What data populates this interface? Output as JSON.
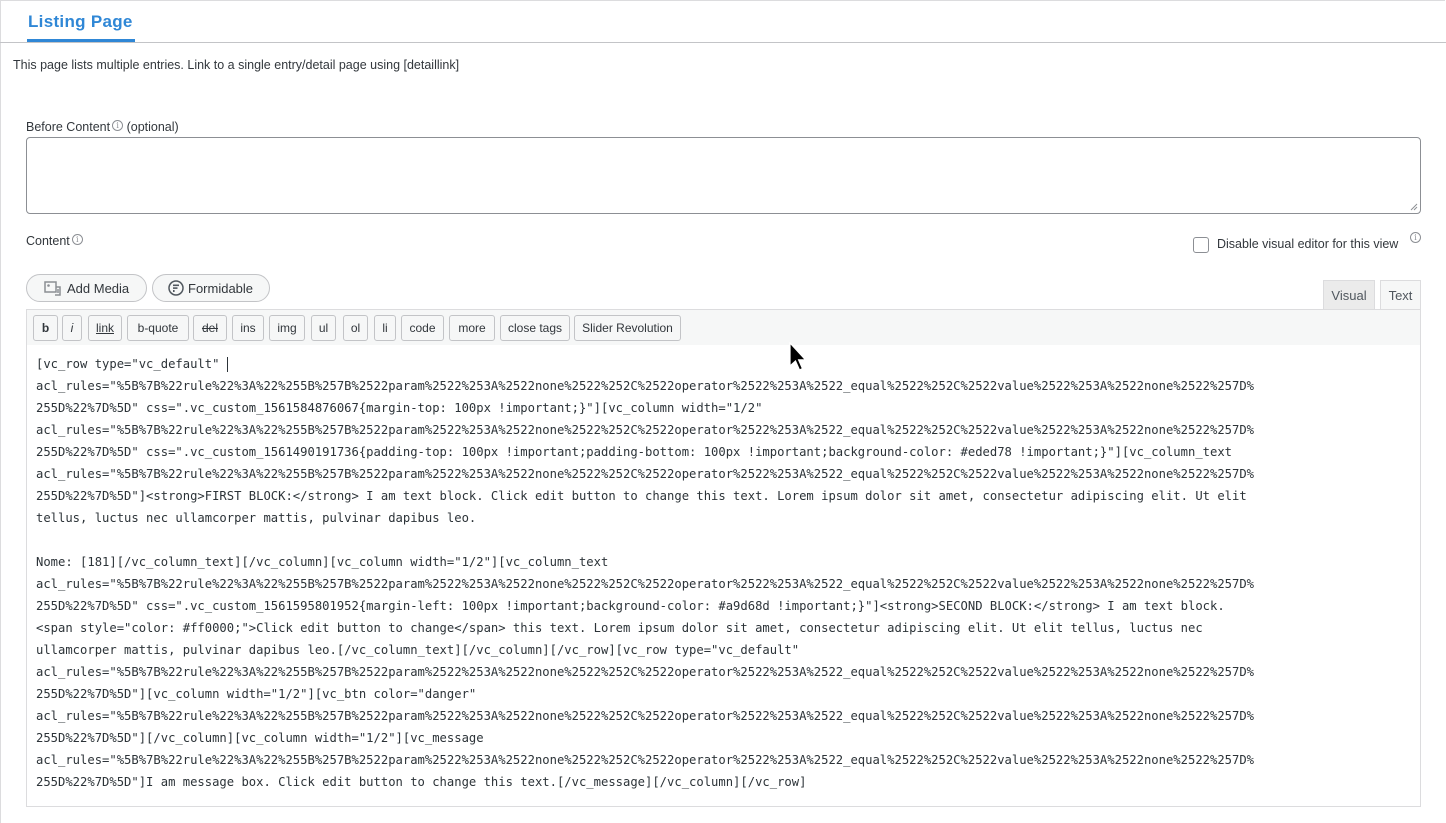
{
  "header": {
    "tab_title": "Listing Page"
  },
  "intro_text": "This page lists multiple entries. Link to a single entry/detail page using [detaillink]",
  "before_content": {
    "label": "Before Content",
    "optional": "(optional)",
    "value": ""
  },
  "content": {
    "label": "Content",
    "disable_visual_label": "Disable visual editor for this view",
    "disable_visual_checked": false
  },
  "media_buttons": {
    "add_media": "Add Media",
    "formidable": "Formidable"
  },
  "editor_tabs": {
    "visual": "Visual",
    "text": "Text",
    "active": "Text"
  },
  "quicktags": [
    "b",
    "i",
    "link",
    "b-quote",
    "del",
    "ins",
    "img",
    "ul",
    "ol",
    "li",
    "code",
    "more",
    "close tags",
    "Slider Revolution"
  ],
  "editor_lines": [
    "[vc_row type=\"vc_default\" ",
    "acl_rules=\"%5B%7B%22rule%22%3A%22%255B%257B%2522param%2522%253A%2522none%2522%252C%2522operator%2522%253A%2522_equal%2522%252C%2522value%2522%253A%2522none%2522%257D%",
    "255D%22%7D%5D\" css=\".vc_custom_1561584876067{margin-top: 100px !important;}\"][vc_column width=\"1/2\"",
    "acl_rules=\"%5B%7B%22rule%22%3A%22%255B%257B%2522param%2522%253A%2522none%2522%252C%2522operator%2522%253A%2522_equal%2522%252C%2522value%2522%253A%2522none%2522%257D%",
    "255D%22%7D%5D\" css=\".vc_custom_1561490191736{padding-top: 100px !important;padding-bottom: 100px !important;background-color: #eded78 !important;}\"][vc_column_text",
    "acl_rules=\"%5B%7B%22rule%22%3A%22%255B%257B%2522param%2522%253A%2522none%2522%252C%2522operator%2522%253A%2522_equal%2522%252C%2522value%2522%253A%2522none%2522%257D%",
    "255D%22%7D%5D\"]<strong>FIRST BLOCK:</strong> I am text block. Click edit button to change this text. Lorem ipsum dolor sit amet, consectetur adipiscing elit. Ut elit",
    "tellus, luctus nec ullamcorper mattis, pulvinar dapibus leo.",
    "",
    "Nome: [181][/vc_column_text][/vc_column][vc_column width=\"1/2\"][vc_column_text",
    "acl_rules=\"%5B%7B%22rule%22%3A%22%255B%257B%2522param%2522%253A%2522none%2522%252C%2522operator%2522%253A%2522_equal%2522%252C%2522value%2522%253A%2522none%2522%257D%",
    "255D%22%7D%5D\" css=\".vc_custom_1561595801952{margin-left: 100px !important;background-color: #a9d68d !important;}\"]<strong>SECOND BLOCK:</strong> I am text block.",
    "<span style=\"color: #ff0000;\">Click edit button to change</span> this text. Lorem ipsum dolor sit amet, consectetur adipiscing elit. Ut elit tellus, luctus nec",
    "ullamcorper mattis, pulvinar dapibus leo.[/vc_column_text][/vc_column][/vc_row][vc_row type=\"vc_default\"",
    "acl_rules=\"%5B%7B%22rule%22%3A%22%255B%257B%2522param%2522%253A%2522none%2522%252C%2522operator%2522%253A%2522_equal%2522%252C%2522value%2522%253A%2522none%2522%257D%",
    "255D%22%7D%5D\"][vc_column width=\"1/2\"][vc_btn color=\"danger\"",
    "acl_rules=\"%5B%7B%22rule%22%3A%22%255B%257B%2522param%2522%253A%2522none%2522%252C%2522operator%2522%253A%2522_equal%2522%252C%2522value%2522%253A%2522none%2522%257D%",
    "255D%22%7D%5D\"][/vc_column][vc_column width=\"1/2\"][vc_message",
    "acl_rules=\"%5B%7B%22rule%22%3A%22%255B%257B%2522param%2522%253A%2522none%2522%252C%2522operator%2522%253A%2522_equal%2522%252C%2522value%2522%253A%2522none%2522%257D%",
    "255D%22%7D%5D\"]I am message box. Click edit button to change this text.[/vc_message][/vc_column][/vc_row]"
  ],
  "icons": {
    "info": "info-icon",
    "add_media": "media-icon",
    "formidable": "formidable-icon",
    "cursor": "mouse-pointer-icon"
  },
  "colors": {
    "accent": "#2f87d6",
    "border": "#8c8f94",
    "toolbar_bg": "#f6f7f7"
  }
}
